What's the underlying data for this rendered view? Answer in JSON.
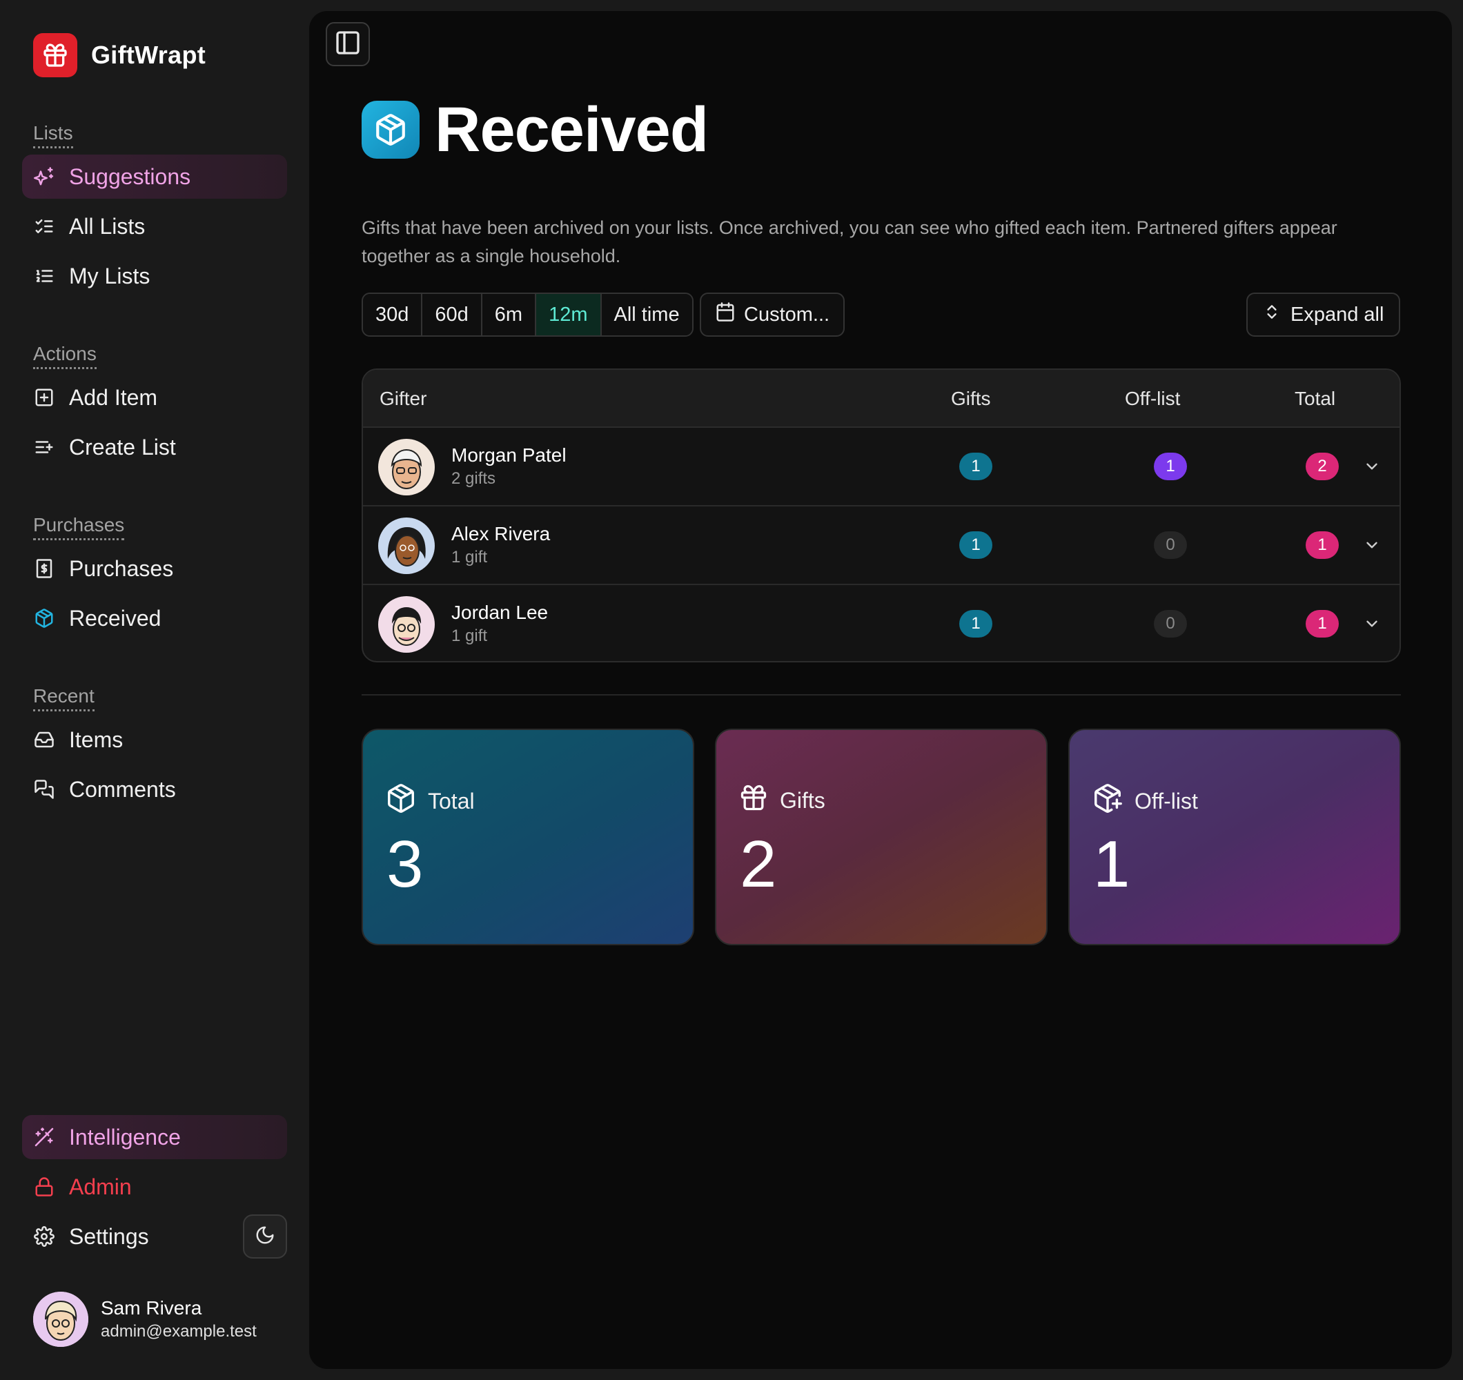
{
  "brand": {
    "name": "GiftWrapt"
  },
  "sidebar": {
    "sections": {
      "lists": "Lists",
      "actions": "Actions",
      "purchases": "Purchases",
      "recent": "Recent"
    },
    "items": {
      "suggestions": "Suggestions",
      "all_lists": "All Lists",
      "my_lists": "My Lists",
      "add_item": "Add Item",
      "create_list": "Create List",
      "purchases": "Purchases",
      "received": "Received",
      "items": "Items",
      "comments": "Comments",
      "intelligence": "Intelligence",
      "admin": "Admin",
      "settings": "Settings"
    },
    "icons": {
      "suggestions": "sparkles-icon",
      "all_lists": "list-checks-icon",
      "my_lists": "list-ordered-icon",
      "add_item": "square-plus-icon",
      "create_list": "list-plus-icon",
      "purchases": "receipt-icon",
      "received": "package-open-icon",
      "items": "inbox-icon",
      "comments": "messages-icon",
      "intelligence": "wand-icon",
      "admin": "lock-icon",
      "settings": "gear-icon"
    },
    "user": {
      "name": "Sam Rivera",
      "email": "admin@example.test"
    }
  },
  "page": {
    "title": "Received",
    "description": "Gifts that have been archived on your lists. Once archived, you can see who gifted each item. Partnered gifters appear together as a single household."
  },
  "filters": {
    "ranges": [
      "30d",
      "60d",
      "6m",
      "12m",
      "All time"
    ],
    "selected": "12m",
    "custom_label": "Custom...",
    "expand_label": "Expand all"
  },
  "table": {
    "headers": {
      "gifter": "Gifter",
      "gifts": "Gifts",
      "offlist": "Off-list",
      "total": "Total"
    },
    "rows": [
      {
        "name": "Morgan Patel",
        "sub": "2 gifts",
        "gifts": "1",
        "offlist": "1",
        "total": "2"
      },
      {
        "name": "Alex Rivera",
        "sub": "1 gift",
        "gifts": "1",
        "offlist": "0",
        "total": "1"
      },
      {
        "name": "Jordan Lee",
        "sub": "1 gift",
        "gifts": "1",
        "offlist": "0",
        "total": "1"
      }
    ]
  },
  "stats": {
    "total": {
      "label": "Total",
      "value": "3"
    },
    "gifts": {
      "label": "Gifts",
      "value": "2"
    },
    "offlist": {
      "label": "Off-list",
      "value": "1"
    }
  },
  "colors": {
    "accent_pink": "#f0a3e6",
    "admin_red": "#f43f4e",
    "gifts_pill": "#0e7490",
    "offlist_pill": "#7c3aed",
    "total_pill": "#db2777",
    "selected_range": "#5eead4"
  }
}
